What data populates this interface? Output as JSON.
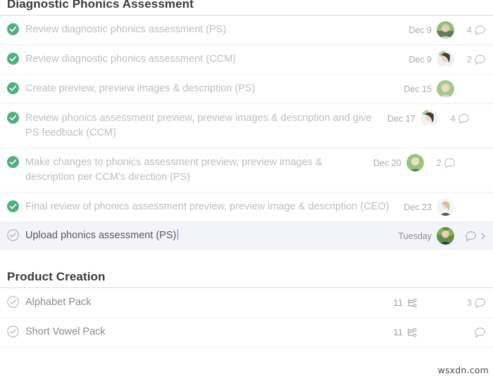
{
  "colors": {
    "check_done": "#52b07f",
    "check_open": "#b0b0b0",
    "active_row_bg": "#f3f3fa",
    "rule": "#d7d7d7",
    "text_done": "#bfbfbf",
    "text_active": "#5a5a5a"
  },
  "sections": [
    {
      "title": "Diagnostic Phonics Assessment",
      "rows": [
        {
          "label": "Review diagnostic phonics assessment (PS)",
          "state": "done",
          "date": "Dec 9",
          "avatar": "avatar-photo",
          "comments": "4",
          "has_bubble": true
        },
        {
          "label": "Review diagnostic phonics assessment (CCM)",
          "state": "done",
          "date": "Dec 9",
          "avatar": "avatar-photo",
          "comments": "2",
          "has_bubble": true
        },
        {
          "label": "Create preview, preview images & description (PS)",
          "state": "done",
          "date": "Dec 15",
          "avatar": "avatar-photo",
          "comments": "",
          "has_bubble": false
        },
        {
          "label": "Review phonics assessment preview, preview images & description and give PS feedback (CCM)",
          "state": "done",
          "date": "Dec 17",
          "avatar": "avatar-photo",
          "comments": "4",
          "has_bubble": true
        },
        {
          "label": "Make changes to phonics assessment preview, preview images & description per CCM's direction (PS)",
          "state": "done",
          "date": "Dec 20",
          "avatar": "avatar-photo",
          "comments": "2",
          "has_bubble": true
        },
        {
          "label": "Final review of phonics assessment preview, preview image & description (CEO)",
          "state": "done",
          "date": "Dec 23",
          "avatar": "avatar-photo",
          "comments": "",
          "has_bubble": false
        },
        {
          "label": "Upload phonics assessment (PS)",
          "state": "open",
          "active": true,
          "date": "Tuesday",
          "avatar": "avatar-photo",
          "comments": "",
          "has_bubble": true,
          "has_chevron": true
        }
      ]
    },
    {
      "title": "Product Creation",
      "rows": [
        {
          "label": "Alphabet Pack",
          "state": "open",
          "subtasks": "11",
          "comments": "3",
          "has_bubble": true
        },
        {
          "label": "Short Vowel Pack",
          "state": "open",
          "subtasks": "11",
          "comments": "",
          "has_bubble": true
        }
      ]
    }
  ],
  "watermark": "wsxdn.com"
}
